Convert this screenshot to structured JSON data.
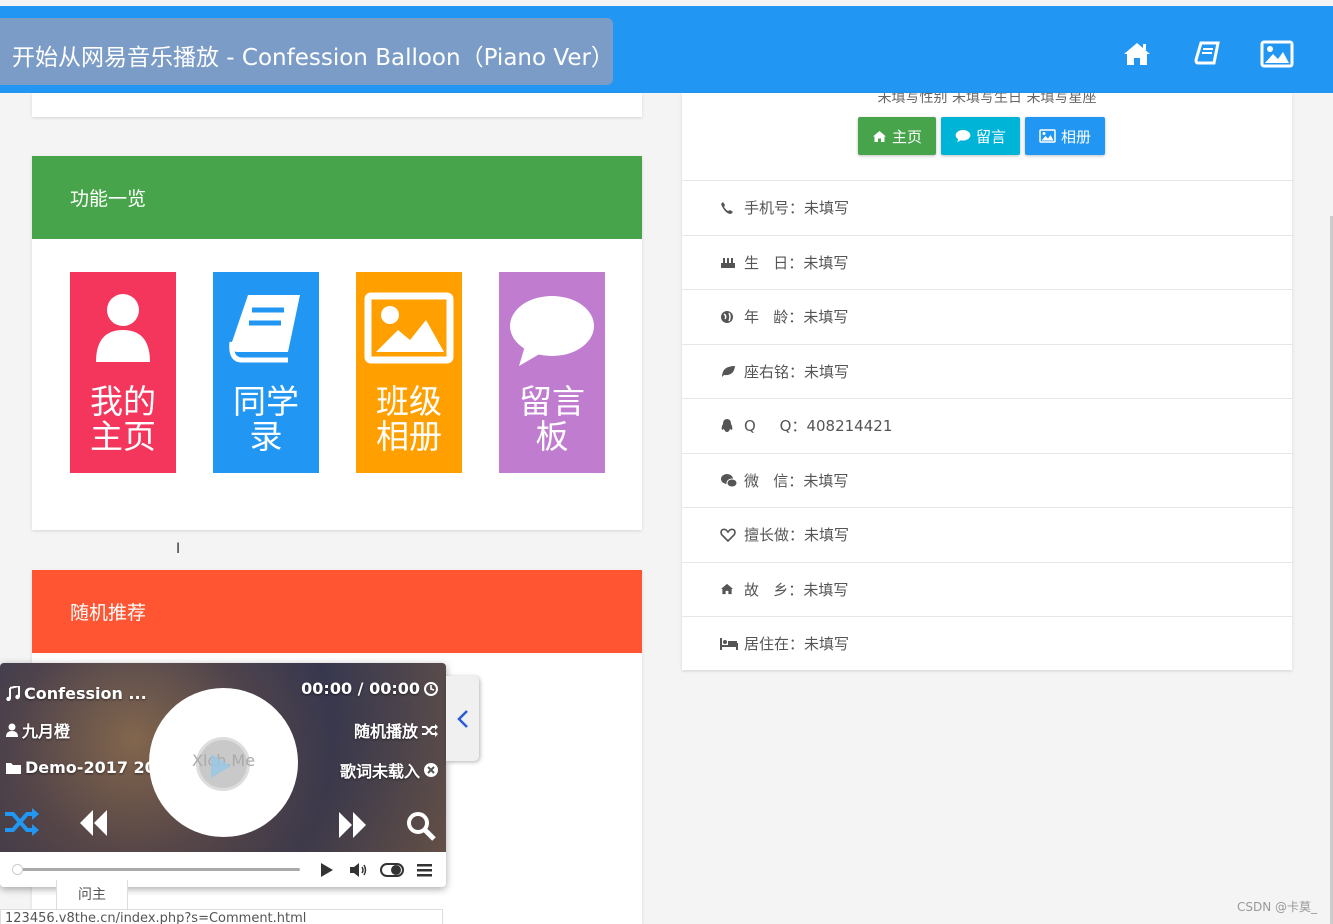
{
  "header": {
    "now_playing": "开始从网易音乐播放 - Confession Balloon（Piano Ver）",
    "icons": [
      "home-icon",
      "book-icon",
      "picture-icon"
    ]
  },
  "features": {
    "title": "功能一览",
    "tiles": [
      {
        "label_1": "我的",
        "label_2": "主页",
        "color": "#f5365c",
        "icon": "user-icon"
      },
      {
        "label_1": "同学",
        "label_2": "录",
        "color": "#2196f3",
        "icon": "book-icon"
      },
      {
        "label_1": "班级",
        "label_2": "相册",
        "color": "#ff9f00",
        "icon": "picture-icon"
      },
      {
        "label_1": "留言",
        "label_2": "板",
        "color": "#c07dd0",
        "icon": "comment-icon"
      }
    ]
  },
  "random": {
    "title": "随机推荐"
  },
  "profile": {
    "subtitle": "未填写性别   未填写生日   未填写星座",
    "buttons": [
      {
        "label": "主页",
        "color": "#47a44b",
        "icon": "home-icon"
      },
      {
        "label": "留言",
        "color": "#00b4d8",
        "icon": "comment-icon"
      },
      {
        "label": "相册",
        "color": "#2196f3",
        "icon": "picture-icon"
      }
    ],
    "rows": [
      {
        "label": "手机号：",
        "value": "未填写",
        "icon": "phone-icon"
      },
      {
        "label": "生   日：",
        "value": "未填写",
        "icon": "cake-icon"
      },
      {
        "label": "年   龄：",
        "value": "未填写",
        "icon": "globe-icon"
      },
      {
        "label": "座右铭：",
        "value": "未填写",
        "icon": "leaf-icon"
      },
      {
        "label": "Q     Q：",
        "value": "408214421",
        "icon": "qq-icon"
      },
      {
        "label": "微   信：",
        "value": "未填写",
        "icon": "wechat-icon"
      },
      {
        "label": "擅长做：",
        "value": "未填写",
        "icon": "heart-icon"
      },
      {
        "label": "故   乡：",
        "value": "未填写",
        "icon": "home-icon"
      },
      {
        "label": "居住在：",
        "value": "未填写",
        "icon": "bed-icon"
      }
    ]
  },
  "player": {
    "song": "Confession ...",
    "artist": "九月橙",
    "album": "Demo-2017 20...",
    "time": "00:00 / 00:00",
    "mode": "随机播放",
    "lyrics": "歌词未载入",
    "cover_text": "Xlch.Me",
    "progress": 0
  },
  "footer": {
    "tab": "问主",
    "url": "123456.v8the.cn/index.php?s=Comment.html",
    "credit": "CSDN @卡莫_"
  }
}
